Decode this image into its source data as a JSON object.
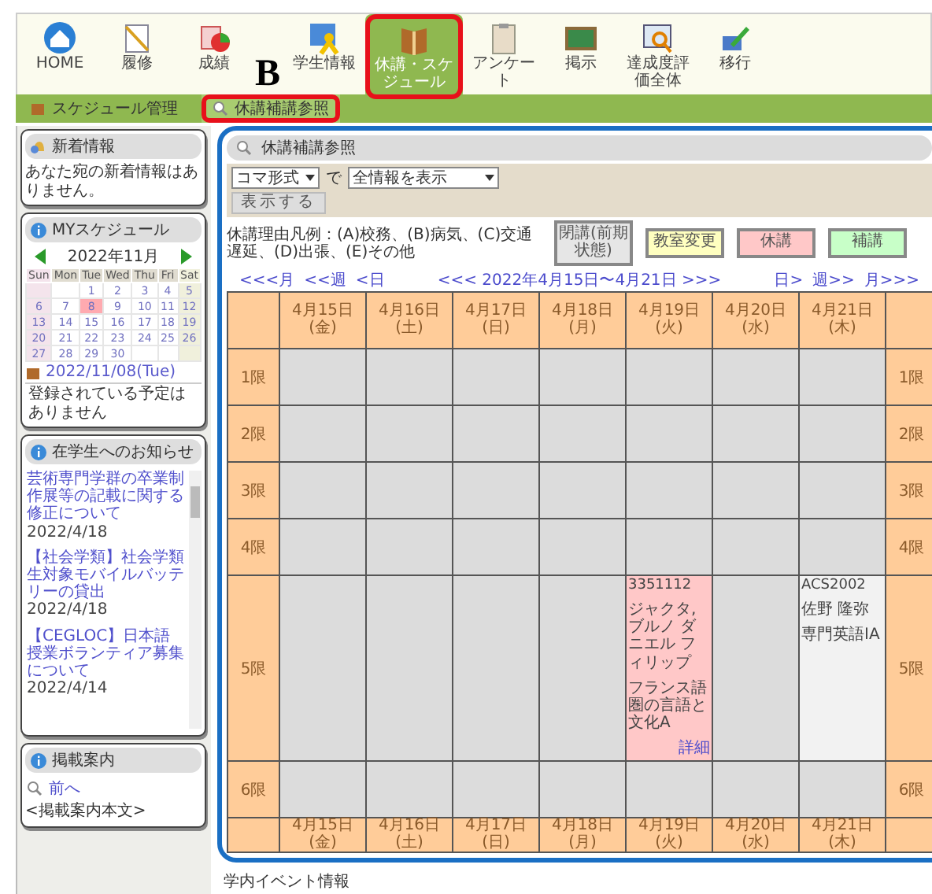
{
  "toolbar": {
    "items": [
      {
        "label": "HOME",
        "selected": false,
        "highlighted": false
      },
      {
        "label": "履修",
        "selected": false,
        "highlighted": false
      },
      {
        "label": "成績",
        "selected": false,
        "highlighted": false
      },
      {
        "label": "学生情報",
        "selected": false,
        "highlighted": false
      },
      {
        "label": "休講・スケジュール",
        "selected": true,
        "highlighted": true
      },
      {
        "label": "アンケート",
        "selected": false,
        "highlighted": false
      },
      {
        "label": "掲示",
        "selected": false,
        "highlighted": false
      },
      {
        "label": "達成度評価全体",
        "selected": false,
        "highlighted": false
      },
      {
        "label": "移行",
        "selected": false,
        "highlighted": false
      }
    ]
  },
  "annotation": {
    "label": "B"
  },
  "tabs": [
    {
      "label": "スケジュール管理",
      "selected": false,
      "highlighted": false
    },
    {
      "label": "休講補講参照",
      "selected": true,
      "highlighted": true
    }
  ],
  "sidebar": {
    "panels": [
      {
        "kind": "message",
        "title": "新着情報",
        "message": "あなた宛の新着情報はありません。"
      },
      {
        "kind": "calendar",
        "title": "MYスケジュール",
        "month": "2022年11月",
        "weekdays": [
          "Sun",
          "Mon",
          "Tue",
          "Wed",
          "Thu",
          "Fri",
          "Sat"
        ],
        "weeks": [
          [
            {
              "day": "1",
              "selected": false
            },
            {
              "day": "2",
              "selected": false
            },
            {
              "day": "3",
              "selected": false
            },
            {
              "day": "4",
              "selected": false
            },
            {
              "day": "5",
              "selected": false
            }
          ],
          [
            {
              "day": "6",
              "selected": false
            },
            {
              "day": "7",
              "selected": false
            },
            {
              "day": "8",
              "selected": true
            },
            {
              "day": "9",
              "selected": false
            },
            {
              "day": "10",
              "selected": false
            },
            {
              "day": "11",
              "selected": false
            },
            {
              "day": "12",
              "selected": false
            }
          ],
          [
            {
              "day": "13",
              "selected": false
            },
            {
              "day": "14",
              "selected": false
            },
            {
              "day": "15",
              "selected": false
            },
            {
              "day": "16",
              "selected": false
            },
            {
              "day": "17",
              "selected": false
            },
            {
              "day": "18",
              "selected": false
            },
            {
              "day": "19",
              "selected": false
            }
          ],
          [
            {
              "day": "20",
              "selected": false
            },
            {
              "day": "21",
              "selected": false
            },
            {
              "day": "22",
              "selected": false
            },
            {
              "day": "23",
              "selected": false
            },
            {
              "day": "24",
              "selected": false
            },
            {
              "day": "25",
              "selected": false
            },
            {
              "day": "26",
              "selected": false
            }
          ],
          [
            {
              "day": "27",
              "selected": false
            },
            {
              "day": "28",
              "selected": false
            },
            {
              "day": "29",
              "selected": false
            },
            {
              "day": "30",
              "selected": false
            }
          ]
        ],
        "date": "2022/11/08(Tue)",
        "message": "登録されている予定はありません"
      },
      {
        "kind": "notices",
        "title": "在学生へのお知らせ",
        "items": [
          {
            "title": "芸術専門学群の卒業制作展等の記載に関する修正について",
            "date": "2022/4/18"
          },
          {
            "title": "【社会学類】社会学類生対象モバイルバッテリーの貸出",
            "date": "2022/4/18"
          },
          {
            "title": "【CEGLOC】日本語授業ボランティア募集について",
            "date": "2022/4/14"
          }
        ]
      },
      {
        "kind": "guide",
        "title": "掲載案内",
        "prev": "前へ",
        "body": "<掲載案内本文>"
      }
    ]
  },
  "main": {
    "highlighted": true,
    "title": "休講補講参照",
    "format_select": "コマ形式",
    "joiner": "で",
    "filter_select": "全情報を表示",
    "submit": "表示する",
    "legend_text": "休講理由凡例：(A)校務、(B)病気、(C)交通遅延、(D)出張、(E)その他",
    "legend": [
      {
        "label": "閉講(前期状態)",
        "color": "#e6e6e6"
      },
      {
        "label": "教室変更",
        "color": "#ffffc0"
      },
      {
        "label": "休講",
        "color": "#ffc8c8"
      },
      {
        "label": "補講",
        "color": "#c8ffc8"
      }
    ],
    "nav_prev": [
      "<<<月",
      "<<週",
      "<日"
    ],
    "range": "<<< 2022年4月15日〜4月21日 >>>",
    "nav_next": [
      "日>",
      "週>>",
      "月>>>"
    ],
    "days": [
      "4月15日 (金)",
      "4月16日 (土)",
      "4月17日 (日)",
      "4月18日 (月)",
      "4月19日 (火)",
      "4月20日 (水)",
      "4月21日 (木)"
    ],
    "periods": [
      {
        "label": "1限",
        "right_label": "1限",
        "cells": [
          {
            "kind": "empty"
          },
          {
            "kind": "empty"
          },
          {
            "kind": "empty"
          },
          {
            "kind": "empty"
          },
          {
            "kind": "empty"
          },
          {
            "kind": "empty"
          },
          {
            "kind": "empty"
          }
        ]
      },
      {
        "label": "2限",
        "right_label": "2限",
        "cells": [
          {
            "kind": "empty"
          },
          {
            "kind": "empty"
          },
          {
            "kind": "empty"
          },
          {
            "kind": "empty"
          },
          {
            "kind": "empty"
          },
          {
            "kind": "empty"
          },
          {
            "kind": "empty"
          }
        ]
      },
      {
        "label": "3限",
        "right_label": "3限",
        "cells": [
          {
            "kind": "empty"
          },
          {
            "kind": "empty"
          },
          {
            "kind": "empty"
          },
          {
            "kind": "empty"
          },
          {
            "kind": "empty"
          },
          {
            "kind": "empty"
          },
          {
            "kind": "empty"
          }
        ]
      },
      {
        "label": "4限",
        "right_label": "4限",
        "cells": [
          {
            "kind": "empty"
          },
          {
            "kind": "empty"
          },
          {
            "kind": "empty"
          },
          {
            "kind": "empty"
          },
          {
            "kind": "empty"
          },
          {
            "kind": "empty"
          },
          {
            "kind": "empty"
          }
        ]
      },
      {
        "label": "5限",
        "right_label": "5限",
        "cells": [
          {
            "kind": "empty"
          },
          {
            "kind": "empty"
          },
          {
            "kind": "empty"
          },
          {
            "kind": "empty"
          },
          {
            "kind": "cancelled",
            "code": "3351112",
            "teacher": "ジャクタ, ブルノ ダニエル フィリップ",
            "course": "フランス語圏の言語と文化A",
            "link": "詳細"
          },
          {
            "kind": "empty"
          },
          {
            "kind": "lecture",
            "code": "ACS2002",
            "teacher": "佐野 隆弥",
            "course": "専門英語IA"
          }
        ]
      },
      {
        "label": "6限",
        "right_label": "6限",
        "cells": [
          {
            "kind": "empty"
          },
          {
            "kind": "empty"
          },
          {
            "kind": "empty"
          },
          {
            "kind": "empty"
          },
          {
            "kind": "empty"
          },
          {
            "kind": "empty"
          },
          {
            "kind": "empty"
          }
        ]
      }
    ],
    "footer_days": [
      "4月15日 (金)",
      "4月16日 (土)",
      "4月17日 (日)",
      "4月18日 (月)",
      "4月19日 (火)",
      "4月20日 (水)",
      "4月21日 (木)"
    ]
  },
  "bottom": {
    "title": "学内イベント情報"
  }
}
